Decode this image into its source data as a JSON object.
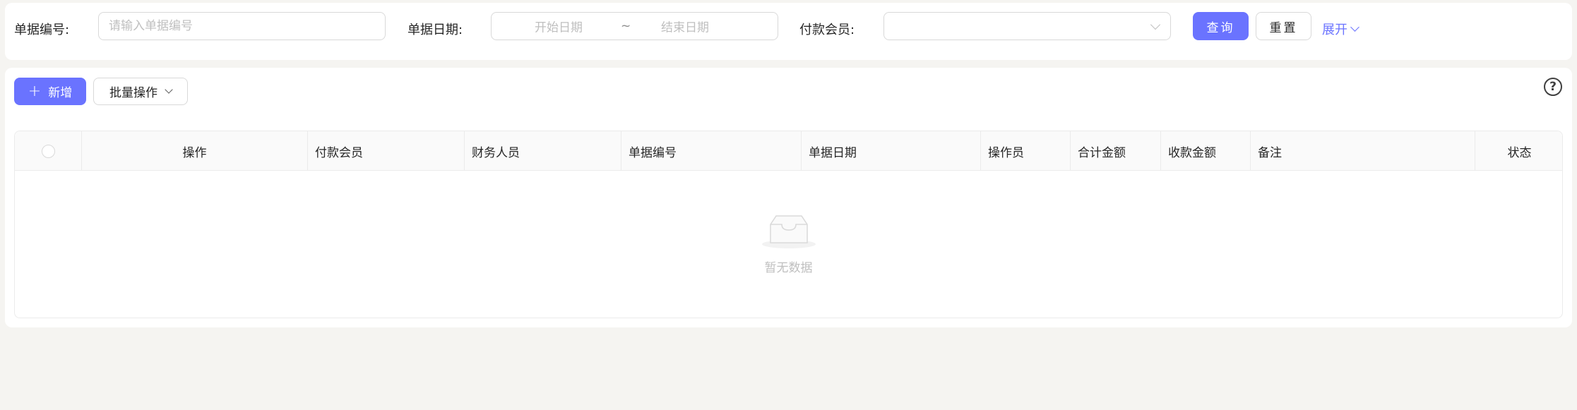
{
  "search": {
    "bill_no_label": "单据编号:",
    "bill_no_placeholder": "请输入单据编号",
    "bill_date_label": "单据日期:",
    "start_date_placeholder": "开始日期",
    "range_separator": "~",
    "end_date_placeholder": "结束日期",
    "payer_label": "付款会员:",
    "payer_value": "",
    "query_label": "查询",
    "reset_label": "重置",
    "expand_label": "展开"
  },
  "toolbar": {
    "add_label": "新增",
    "batch_label": "批量操作",
    "help_glyph": "?"
  },
  "table": {
    "columns": [
      "操作",
      "付款会员",
      "财务人员",
      "单据编号",
      "单据日期",
      "操作员",
      "合计金额",
      "收款金额",
      "备注",
      "状态"
    ],
    "rows": [],
    "empty_text": "暂无数据"
  },
  "colors": {
    "primary": "#6a73ff",
    "background": "#f5f4f1"
  }
}
